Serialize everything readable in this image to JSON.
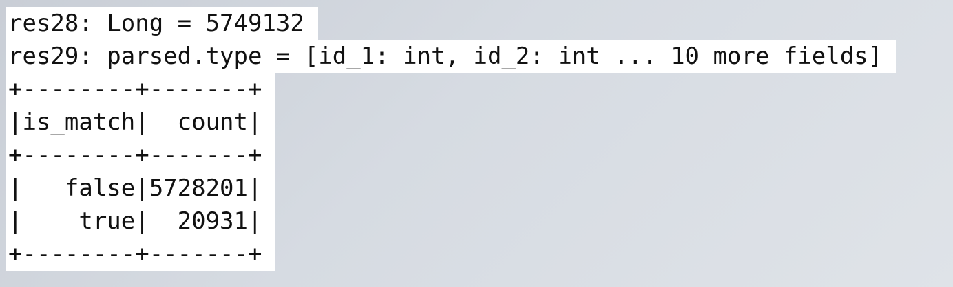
{
  "output": {
    "lines": [
      "res28: Long = 5749132",
      "res29: parsed.type = [id_1: int, id_2: int ... 10 more fields]",
      "+--------+-------+",
      "|is_match|  count|",
      "+--------+-------+",
      "|   false|5728201|",
      "|    true|  20931|",
      "+--------+-------+"
    ]
  },
  "colors": {
    "text": "#111111",
    "line_background": "#ffffff",
    "desktop_background": "#d3d8df"
  }
}
